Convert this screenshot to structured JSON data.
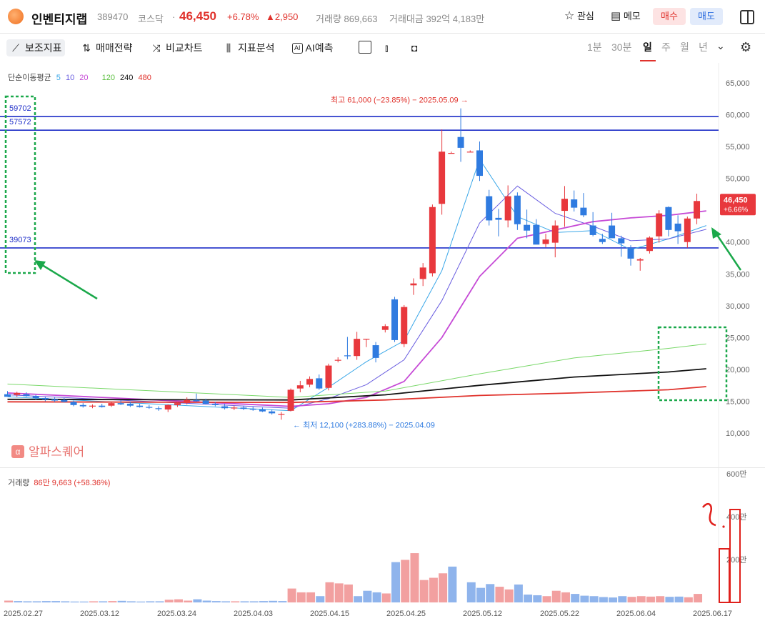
{
  "header": {
    "name": "인벤티지랩",
    "code": "389470",
    "market": "코스닥",
    "separator": "·",
    "price": "46,450",
    "change_pct": "+6.78%",
    "change": "▲2,950",
    "volume": "거래량 869,663",
    "amount": "거래대금 392억 4,183만",
    "watch_label": "관심",
    "memo_label": "메모",
    "buy_label": "매수",
    "sell_label": "매도"
  },
  "toolbar": {
    "indicators": "보조지표",
    "strategy": "매매전략",
    "compare": "비교차트",
    "analysis": "지표분석",
    "ai_badge": "AI",
    "ai_predict": "AI예측",
    "periods": [
      "1분",
      "30분",
      "일",
      "주",
      "월",
      "년"
    ],
    "selected_period": "일"
  },
  "ma_legend": {
    "label": "단순이동평균",
    "p5": "5",
    "p10": "10",
    "p20": "20",
    "p120": "120",
    "p240": "240",
    "p480": "480",
    "colors": {
      "p5": "#3aa7e8",
      "p10": "#6a5ee0",
      "p20": "#c64ad6",
      "p120": "#5cc040",
      "p240": "#111111",
      "p480": "#e0322c"
    }
  },
  "annotations": {
    "high": "최고 61,000 (−23.85%) − 2025.05.09 →",
    "low": "← 최저 12,100 (+283.88%) − 2025.04.09",
    "level1": "59702",
    "level2": "57572",
    "level3": "39073",
    "last_price": "46,450",
    "last_pct": "+6.66%"
  },
  "watermark": "알파스퀘어",
  "volume_panel": {
    "label": "거래량",
    "value": "86만 9,663 (+58.36%)",
    "axis": [
      "600만",
      "400만",
      "200만"
    ]
  },
  "colors": {
    "up": "#e8383d",
    "down": "#2f7be0",
    "level": "#1f2fc8",
    "annotation_green": "#1aa84a",
    "up_vol": "#f2a0a0",
    "down_vol": "#8fb4ec"
  },
  "chart_data": {
    "type": "candlestick",
    "y_axis": {
      "ticks": [
        "65,000",
        "60,000",
        "55,000",
        "50,000",
        "45,000",
        "40,000",
        "35,000",
        "30,000",
        "25,000",
        "20,000",
        "15,000",
        "10,000"
      ]
    },
    "x_labels": [
      "2025.02.27",
      "2025.03.12",
      "2025.03.24",
      "2025.04.03",
      "2025.04.15",
      "2025.04.25",
      "2025.05.12",
      "2025.05.22",
      "2025.06.04",
      "2025.06.17"
    ],
    "horizontal_levels": [
      59702,
      57572,
      39073
    ],
    "high": 61000,
    "low": 12100,
    "candles": [
      {
        "o": 16100,
        "h": 16600,
        "l": 15800,
        "c": 15700
      },
      {
        "o": 16000,
        "h": 16500,
        "l": 15700,
        "c": 16300
      },
      {
        "o": 16100,
        "h": 16400,
        "l": 15700,
        "c": 15800
      },
      {
        "o": 15800,
        "h": 16000,
        "l": 15200,
        "c": 15500
      },
      {
        "o": 15500,
        "h": 15700,
        "l": 15000,
        "c": 15300
      },
      {
        "o": 15300,
        "h": 15600,
        "l": 14900,
        "c": 15100
      },
      {
        "o": 15200,
        "h": 15500,
        "l": 14800,
        "c": 14900
      },
      {
        "o": 14900,
        "h": 15100,
        "l": 14200,
        "c": 14400
      },
      {
        "o": 14400,
        "h": 14700,
        "l": 14000,
        "c": 14200
      },
      {
        "o": 14200,
        "h": 14500,
        "l": 13900,
        "c": 14300
      },
      {
        "o": 14300,
        "h": 14600,
        "l": 14000,
        "c": 14100
      },
      {
        "o": 14300,
        "h": 14800,
        "l": 14100,
        "c": 14700
      },
      {
        "o": 14700,
        "h": 15100,
        "l": 14400,
        "c": 14500
      },
      {
        "o": 14600,
        "h": 14900,
        "l": 14100,
        "c": 14300
      },
      {
        "o": 14300,
        "h": 14600,
        "l": 14000,
        "c": 14100
      },
      {
        "o": 14100,
        "h": 14400,
        "l": 13800,
        "c": 14000
      },
      {
        "o": 13900,
        "h": 14200,
        "l": 13500,
        "c": 13800
      },
      {
        "o": 13700,
        "h": 14500,
        "l": 13300,
        "c": 14400
      },
      {
        "o": 14400,
        "h": 14900,
        "l": 14100,
        "c": 14700
      },
      {
        "o": 14700,
        "h": 15600,
        "l": 14500,
        "c": 15200
      },
      {
        "o": 15200,
        "h": 16200,
        "l": 14900,
        "c": 15000
      },
      {
        "o": 15100,
        "h": 15400,
        "l": 14500,
        "c": 14600
      },
      {
        "o": 14600,
        "h": 14900,
        "l": 14200,
        "c": 14400
      },
      {
        "o": 14200,
        "h": 14600,
        "l": 13700,
        "c": 13900
      },
      {
        "o": 13900,
        "h": 14300,
        "l": 13600,
        "c": 14000
      },
      {
        "o": 14000,
        "h": 14300,
        "l": 13600,
        "c": 13800
      },
      {
        "o": 13800,
        "h": 14200,
        "l": 13500,
        "c": 13700
      },
      {
        "o": 13700,
        "h": 14000,
        "l": 13300,
        "c": 13400
      },
      {
        "o": 13400,
        "h": 13700,
        "l": 12900,
        "c": 13100
      },
      {
        "o": 12900,
        "h": 13300,
        "l": 12100,
        "c": 13000
      },
      {
        "o": 13500,
        "h": 17000,
        "l": 13400,
        "c": 16800
      },
      {
        "o": 17000,
        "h": 18200,
        "l": 16400,
        "c": 17500
      },
      {
        "o": 17600,
        "h": 18900,
        "l": 17200,
        "c": 18500
      },
      {
        "o": 18600,
        "h": 19200,
        "l": 16800,
        "c": 17000
      },
      {
        "o": 17100,
        "h": 20900,
        "l": 16700,
        "c": 20600
      },
      {
        "o": 21500,
        "h": 21900,
        "l": 21100,
        "c": 21500
      },
      {
        "o": 22200,
        "h": 25100,
        "l": 21600,
        "c": 22100
      },
      {
        "o": 22100,
        "h": 25900,
        "l": 21500,
        "c": 24800
      },
      {
        "o": 24800,
        "h": 24800,
        "l": 23500,
        "c": 24800
      },
      {
        "o": 23800,
        "h": 24300,
        "l": 21100,
        "c": 21800
      },
      {
        "o": 26200,
        "h": 27100,
        "l": 25800,
        "c": 26800
      },
      {
        "o": 31000,
        "h": 31400,
        "l": 24300,
        "c": 24600
      },
      {
        "o": 24000,
        "h": 30100,
        "l": 23500,
        "c": 29800
      },
      {
        "o": 33200,
        "h": 34300,
        "l": 31700,
        "c": 33500
      },
      {
        "o": 34200,
        "h": 36700,
        "l": 33100,
        "c": 36000
      },
      {
        "o": 35100,
        "h": 45900,
        "l": 34600,
        "c": 45500
      },
      {
        "o": 46000,
        "h": 57700,
        "l": 44300,
        "c": 54200
      },
      {
        "o": 54000,
        "h": 54200,
        "l": 53900,
        "c": 54000
      },
      {
        "o": 56500,
        "h": 61000,
        "l": 52600,
        "c": 54800
      },
      {
        "o": 54200,
        "h": 54400,
        "l": 54100,
        "c": 54200
      },
      {
        "o": 54400,
        "h": 55800,
        "l": 49600,
        "c": 50400
      },
      {
        "o": 47200,
        "h": 48200,
        "l": 42600,
        "c": 43400
      },
      {
        "o": 43800,
        "h": 45200,
        "l": 40900,
        "c": 43500
      },
      {
        "o": 43400,
        "h": 48900,
        "l": 42300,
        "c": 47200
      },
      {
        "o": 47300,
        "h": 47800,
        "l": 41900,
        "c": 42800
      },
      {
        "o": 42700,
        "h": 45100,
        "l": 40600,
        "c": 41800
      },
      {
        "o": 42700,
        "h": 43600,
        "l": 40100,
        "c": 39600
      },
      {
        "o": 39700,
        "h": 41300,
        "l": 39200,
        "c": 40400
      },
      {
        "o": 39900,
        "h": 43400,
        "l": 37600,
        "c": 42600
      },
      {
        "o": 44900,
        "h": 48800,
        "l": 42400,
        "c": 46800
      },
      {
        "o": 46700,
        "h": 48100,
        "l": 44800,
        "c": 45400
      },
      {
        "o": 45400,
        "h": 47700,
        "l": 43900,
        "c": 44200
      },
      {
        "o": 42600,
        "h": 44700,
        "l": 40900,
        "c": 41100
      },
      {
        "o": 40500,
        "h": 41300,
        "l": 39700,
        "c": 40000
      },
      {
        "o": 42600,
        "h": 44600,
        "l": 40800,
        "c": 40600
      },
      {
        "o": 40600,
        "h": 41000,
        "l": 37700,
        "c": 39800
      },
      {
        "o": 39100,
        "h": 39500,
        "l": 36300,
        "c": 37400
      },
      {
        "o": 37100,
        "h": 37500,
        "l": 35500,
        "c": 37300
      },
      {
        "o": 38600,
        "h": 40900,
        "l": 38200,
        "c": 40700
      },
      {
        "o": 40900,
        "h": 45000,
        "l": 39900,
        "c": 44500
      },
      {
        "o": 45500,
        "h": 45600,
        "l": 40900,
        "c": 41900
      },
      {
        "o": 42900,
        "h": 44200,
        "l": 39700,
        "c": 41700
      },
      {
        "o": 40000,
        "h": 44000,
        "l": 39100,
        "c": 43700
      },
      {
        "o": 43700,
        "h": 47600,
        "l": 42800,
        "c": 46450
      }
    ],
    "moving_averages": {
      "ma5": {
        "x": [
          0,
          30,
          34,
          38,
          42,
          46,
          50,
          54,
          58,
          62,
          66,
          70,
          74
        ],
        "y": [
          15700,
          13500,
          17200,
          21200,
          24500,
          35500,
          53000,
          44000,
          41500,
          41800,
          38800,
          40500,
          42600
        ]
      },
      "ma10": {
        "x": [
          0,
          30,
          34,
          38,
          42,
          46,
          50,
          54,
          58,
          62,
          66,
          70,
          74
        ],
        "y": [
          16000,
          13900,
          15400,
          17600,
          21500,
          30800,
          43000,
          48800,
          44500,
          42500,
          40200,
          40500,
          42000
        ]
      },
      "ma20": {
        "x": [
          0,
          30,
          34,
          38,
          42,
          46,
          50,
          54,
          58,
          62,
          66,
          70,
          74
        ],
        "y": [
          16300,
          14200,
          14600,
          15600,
          18100,
          25000,
          34600,
          40600,
          41900,
          43200,
          43800,
          44200,
          44900
        ]
      },
      "ma120": {
        "x": [
          0,
          30,
          40,
          50,
          60,
          70,
          74
        ],
        "y": [
          17700,
          15600,
          16600,
          19300,
          21800,
          23300,
          24000
        ]
      },
      "ma240": {
        "x": [
          0,
          30,
          40,
          50,
          60,
          70,
          74
        ],
        "y": [
          15300,
          15200,
          16000,
          17500,
          18800,
          19600,
          20100
        ]
      },
      "ma480": {
        "x": [
          0,
          30,
          40,
          50,
          60,
          70,
          74
        ],
        "y": [
          14900,
          14800,
          15200,
          15900,
          16300,
          16800,
          17300
        ]
      }
    },
    "volume_bars": [
      8,
      6,
      5,
      5,
      6,
      6,
      5,
      4,
      4,
      5,
      5,
      6,
      7,
      5,
      4,
      5,
      5,
      12,
      14,
      8,
      14,
      8,
      6,
      5,
      5,
      5,
      5,
      6,
      7,
      6,
      62,
      45,
      45,
      28,
      90,
      85,
      80,
      28,
      52,
      45,
      40,
      180,
      190,
      220,
      100,
      110,
      130,
      160,
      0,
      90,
      65,
      82,
      70,
      58,
      80,
      35,
      32,
      28,
      52,
      45,
      38,
      30,
      28,
      24,
      22,
      28,
      25,
      28,
      26,
      28,
      25,
      26,
      23,
      38
    ],
    "volume_up": [
      1,
      0,
      0,
      0,
      0,
      0,
      0,
      0,
      0,
      1,
      0,
      1,
      0,
      0,
      0,
      0,
      0,
      1,
      1,
      1,
      0,
      0,
      0,
      0,
      1,
      0,
      0,
      0,
      0,
      0,
      1,
      1,
      1,
      0,
      1,
      1,
      1,
      0,
      0,
      0,
      1,
      0,
      1,
      1,
      1,
      1,
      1,
      0,
      0,
      0,
      0,
      0,
      1,
      1,
      0,
      0,
      0,
      1,
      1,
      1,
      0,
      0,
      0,
      0,
      0,
      0,
      1,
      1,
      1,
      1,
      0,
      0,
      1,
      1
    ]
  }
}
